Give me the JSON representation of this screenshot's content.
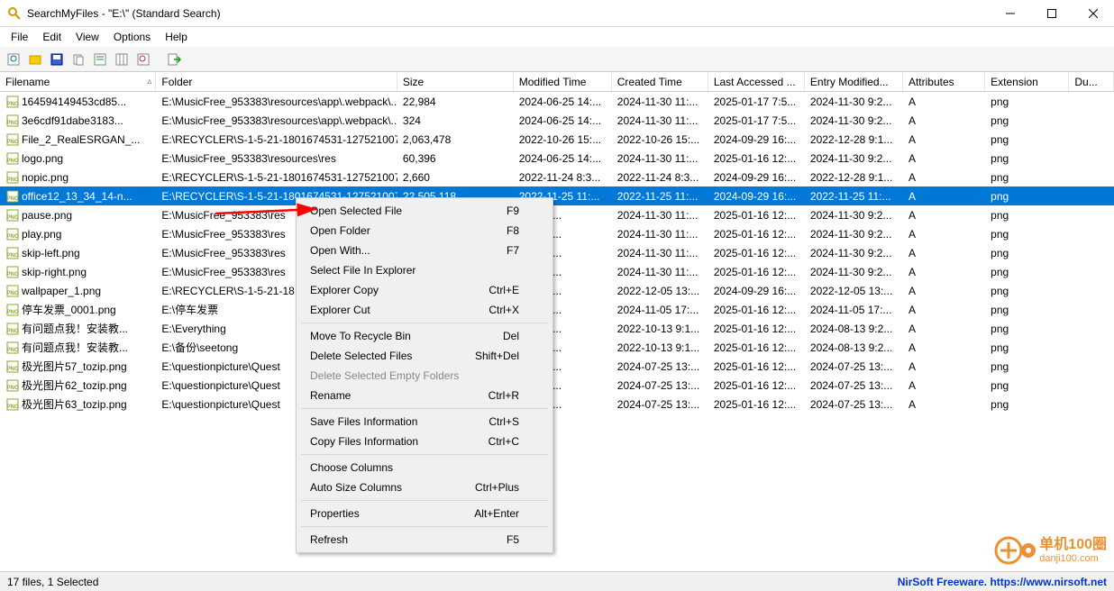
{
  "title": "SearchMyFiles - \"E:\\\"  (Standard Search)",
  "menu": {
    "file": "File",
    "edit": "Edit",
    "view": "View",
    "options": "Options",
    "help": "Help"
  },
  "columns": [
    "Filename",
    "Folder",
    "Size",
    "Modified Time",
    "Created Time",
    "Last Accessed ...",
    "Entry Modified...",
    "Attributes",
    "Extension",
    "Du..."
  ],
  "sort_indicator": "▵",
  "rows": [
    {
      "filename": "164594149453cd85...",
      "folder": "E:\\MusicFree_953383\\resources\\app\\.webpack\\...",
      "size": "22,984",
      "modified": "2024-06-25 14:...",
      "created": "2024-11-30 11:...",
      "accessed": "2025-01-17 7:5...",
      "entry": "2024-11-30 9:2...",
      "attr": "A",
      "ext": "png"
    },
    {
      "filename": "3e6cdf91dabe3183...",
      "folder": "E:\\MusicFree_953383\\resources\\app\\.webpack\\...",
      "size": "324",
      "modified": "2024-06-25 14:...",
      "created": "2024-11-30 11:...",
      "accessed": "2025-01-17 7:5...",
      "entry": "2024-11-30 9:2...",
      "attr": "A",
      "ext": "png"
    },
    {
      "filename": "File_2_RealESRGAN_...",
      "folder": "E:\\RECYCLER\\S-1-5-21-1801674531-1275210071...",
      "size": "2,063,478",
      "modified": "2022-10-26 15:...",
      "created": "2022-10-26 15:...",
      "accessed": "2024-09-29 16:...",
      "entry": "2022-12-28 9:1...",
      "attr": "A",
      "ext": "png"
    },
    {
      "filename": "logo.png",
      "folder": "E:\\MusicFree_953383\\resources\\res",
      "size": "60,396",
      "modified": "2024-06-25 14:...",
      "created": "2024-11-30 11:...",
      "accessed": "2025-01-16 12:...",
      "entry": "2024-11-30 9:2...",
      "attr": "A",
      "ext": "png"
    },
    {
      "filename": "nopic.png",
      "folder": "E:\\RECYCLER\\S-1-5-21-1801674531-1275210071...",
      "size": "2,660",
      "modified": "2022-11-24 8:3...",
      "created": "2022-11-24 8:3...",
      "accessed": "2024-09-29 16:...",
      "entry": "2022-12-28 9:1...",
      "attr": "A",
      "ext": "png"
    },
    {
      "filename": "office12_13_34_14-n...",
      "folder": "E:\\RECYCLER\\S-1-5-21-1801674531-1275210071...",
      "size": "22,505,118",
      "modified": "2022-11-25 11:...",
      "created": "2022-11-25 11:...",
      "accessed": "2024-09-29 16:...",
      "entry": "2022-11-25 11:...",
      "attr": "A",
      "ext": "png",
      "selected": true
    },
    {
      "filename": "pause.png",
      "folder": "E:\\MusicFree_953383\\res",
      "size": "",
      "modified": "-25 14:...",
      "created": "2024-11-30 11:...",
      "accessed": "2025-01-16 12:...",
      "entry": "2024-11-30 9:2...",
      "attr": "A",
      "ext": "png"
    },
    {
      "filename": "play.png",
      "folder": "E:\\MusicFree_953383\\res",
      "size": "",
      "modified": "-25 14:...",
      "created": "2024-11-30 11:...",
      "accessed": "2025-01-16 12:...",
      "entry": "2024-11-30 9:2...",
      "attr": "A",
      "ext": "png"
    },
    {
      "filename": "skip-left.png",
      "folder": "E:\\MusicFree_953383\\res",
      "size": "",
      "modified": "-25 14:...",
      "created": "2024-11-30 11:...",
      "accessed": "2025-01-16 12:...",
      "entry": "2024-11-30 9:2...",
      "attr": "A",
      "ext": "png"
    },
    {
      "filename": "skip-right.png",
      "folder": "E:\\MusicFree_953383\\res",
      "size": "",
      "modified": "-25 14:...",
      "created": "2024-11-30 11:...",
      "accessed": "2025-01-16 12:...",
      "entry": "2024-11-30 9:2...",
      "attr": "A",
      "ext": "png"
    },
    {
      "filename": "wallpaper_1.png",
      "folder": "E:\\RECYCLER\\S-1-5-21-18",
      "size": "",
      "modified": "-05 13:...",
      "created": "2022-12-05 13:...",
      "accessed": "2024-09-29 16:...",
      "entry": "2022-12-05 13:...",
      "attr": "A",
      "ext": "png"
    },
    {
      "filename": "停车发票_0001.png",
      "folder": "E:\\停车发票",
      "size": "",
      "modified": "-05 17:...",
      "created": "2024-11-05 17:...",
      "accessed": "2025-01-16 12:...",
      "entry": "2024-11-05 17:...",
      "attr": "A",
      "ext": "png"
    },
    {
      "filename": "有问题点我！安装教...",
      "folder": "E:\\Everything",
      "size": "",
      "modified": "-02 17:...",
      "created": "2022-10-13 9:1...",
      "accessed": "2025-01-16 12:...",
      "entry": "2024-08-13 9:2...",
      "attr": "A",
      "ext": "png"
    },
    {
      "filename": "有问题点我！安装教...",
      "folder": "E:\\备份\\seetong",
      "size": "",
      "modified": "-02 17:...",
      "created": "2022-10-13 9:1...",
      "accessed": "2025-01-16 12:...",
      "entry": "2024-08-13 9:2...",
      "attr": "A",
      "ext": "png"
    },
    {
      "filename": "极光图片57_tozip.png",
      "folder": "E:\\questionpicture\\Quest",
      "size": "",
      "modified": "-25 13:...",
      "created": "2024-07-25 13:...",
      "accessed": "2025-01-16 12:...",
      "entry": "2024-07-25 13:...",
      "attr": "A",
      "ext": "png"
    },
    {
      "filename": "极光图片62_tozip.png",
      "folder": "E:\\questionpicture\\Quest",
      "size": "",
      "modified": "-25 13:...",
      "created": "2024-07-25 13:...",
      "accessed": "2025-01-16 12:...",
      "entry": "2024-07-25 13:...",
      "attr": "A",
      "ext": "png"
    },
    {
      "filename": "极光图片63_tozip.png",
      "folder": "E:\\questionpicture\\Quest",
      "size": "",
      "modified": "-25 13:...",
      "created": "2024-07-25 13:...",
      "accessed": "2025-01-16 12:...",
      "entry": "2024-07-25 13:...",
      "attr": "A",
      "ext": "png"
    }
  ],
  "context_menu": [
    {
      "type": "item",
      "label": "Open Selected File",
      "shortcut": "F9"
    },
    {
      "type": "item",
      "label": "Open Folder",
      "shortcut": "F8"
    },
    {
      "type": "item",
      "label": "Open With...",
      "shortcut": "F7"
    },
    {
      "type": "item",
      "label": "Select File In Explorer",
      "shortcut": ""
    },
    {
      "type": "item",
      "label": "Explorer Copy",
      "shortcut": "Ctrl+E"
    },
    {
      "type": "item",
      "label": "Explorer Cut",
      "shortcut": "Ctrl+X"
    },
    {
      "type": "sep"
    },
    {
      "type": "item",
      "label": "Move To Recycle Bin",
      "shortcut": "Del"
    },
    {
      "type": "item",
      "label": "Delete Selected Files",
      "shortcut": "Shift+Del"
    },
    {
      "type": "item",
      "label": "Delete Selected Empty Folders",
      "shortcut": "",
      "disabled": true
    },
    {
      "type": "item",
      "label": "Rename",
      "shortcut": "Ctrl+R"
    },
    {
      "type": "sep"
    },
    {
      "type": "item",
      "label": "Save Files Information",
      "shortcut": "Ctrl+S"
    },
    {
      "type": "item",
      "label": "Copy Files Information",
      "shortcut": "Ctrl+C"
    },
    {
      "type": "sep"
    },
    {
      "type": "item",
      "label": "Choose Columns",
      "shortcut": ""
    },
    {
      "type": "item",
      "label": "Auto Size Columns",
      "shortcut": "Ctrl+Plus"
    },
    {
      "type": "sep"
    },
    {
      "type": "item",
      "label": "Properties",
      "shortcut": "Alt+Enter"
    },
    {
      "type": "sep"
    },
    {
      "type": "item",
      "label": "Refresh",
      "shortcut": "F5"
    }
  ],
  "status": {
    "left": "17 files, 1 Selected",
    "right": "NirSoft Freeware. https://www.nirsoft.net"
  },
  "watermark": "单机100圈\ndanji100.com"
}
